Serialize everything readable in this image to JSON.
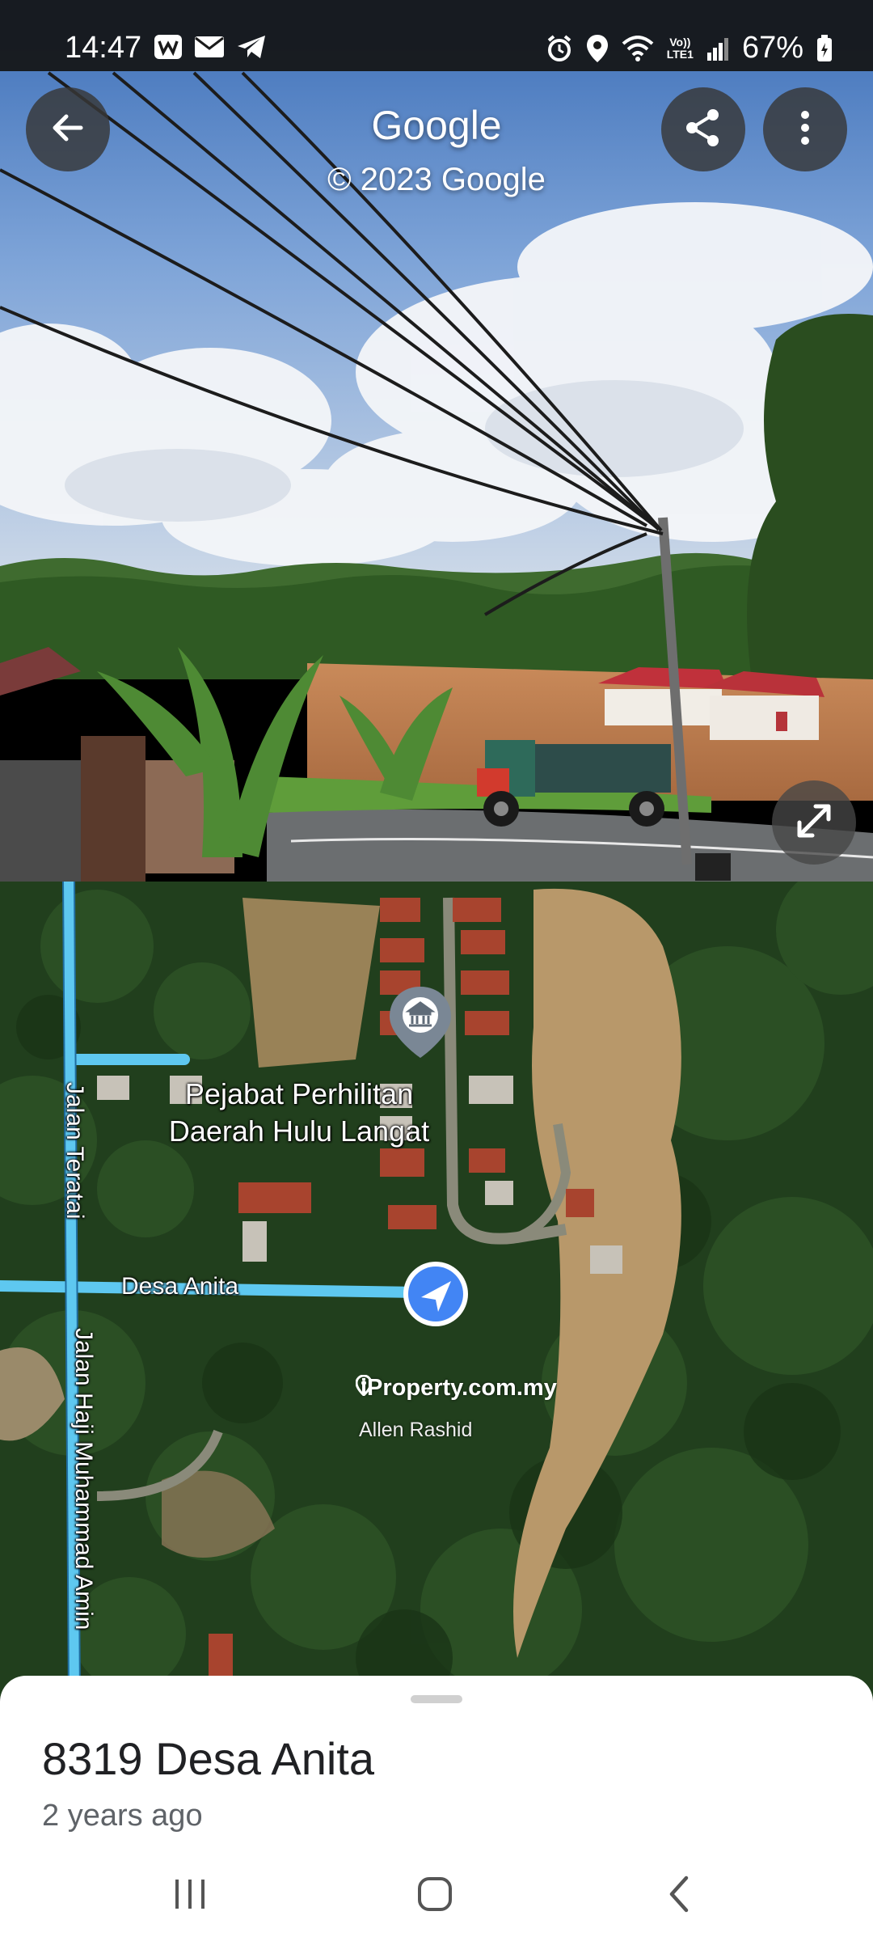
{
  "status_bar": {
    "time": "14:47",
    "battery": "67%",
    "network": "LTE1",
    "volte": "Vo))"
  },
  "street_view": {
    "title": "Google",
    "copyright": "© 2023 Google"
  },
  "map": {
    "poi_label": "Pejabat Perhilitan Daerah Hulu Langat",
    "road_desa_anita": "Desa Anita",
    "road_jalan_teratai": "Jalan Teratai",
    "road_jalan_haji": "Jalan Haji Muhammad Amin",
    "watermark": "iProperty.com.my",
    "watermark_name": "Allen Rashid"
  },
  "bottom_sheet": {
    "title": "8319 Desa Anita",
    "subtitle": "2 years ago"
  },
  "colors": {
    "road_highlight": "#5ec8f0",
    "location_arrow": "#4285f4"
  }
}
